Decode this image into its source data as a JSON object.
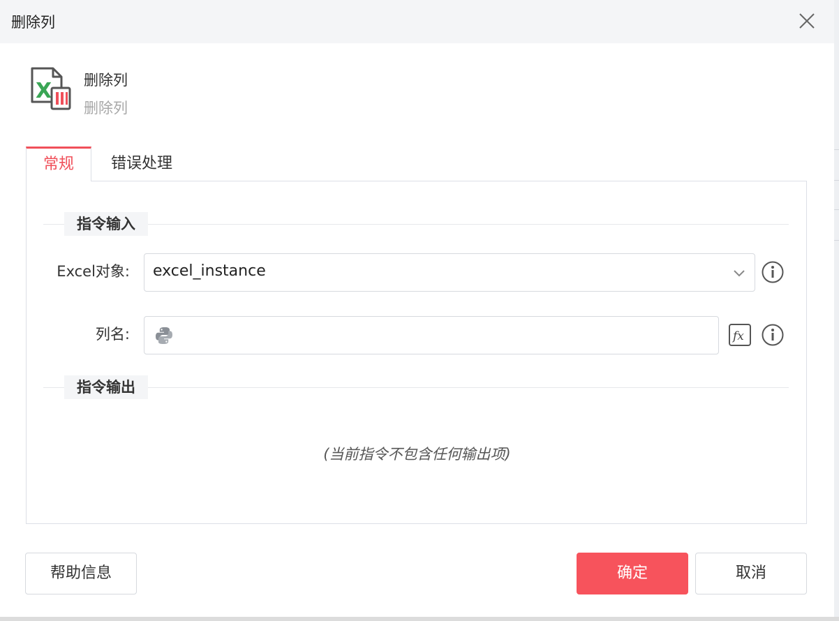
{
  "dialog": {
    "title": "删除列",
    "close_icon": "close-icon"
  },
  "command": {
    "icon": "excel-delete-column-icon",
    "name": "删除列",
    "subtitle": "删除列"
  },
  "tabs": [
    {
      "label": "常规",
      "active": true
    },
    {
      "label": "错误处理",
      "active": false
    }
  ],
  "input_section": {
    "title": "指令输入",
    "fields": {
      "excel_object": {
        "label": "Excel对象:",
        "value": "excel_instance"
      },
      "column_name": {
        "label": "列名:",
        "value": ""
      }
    }
  },
  "output_section": {
    "title": "指令输出",
    "empty_text": "(当前指令不包含任何输出项)"
  },
  "footer": {
    "help_label": "帮助信息",
    "ok_label": "确定",
    "cancel_label": "取消"
  },
  "colors": {
    "accent": "#f0505a",
    "primary_button": "#f7535c",
    "excel_green": "#3aa655"
  }
}
